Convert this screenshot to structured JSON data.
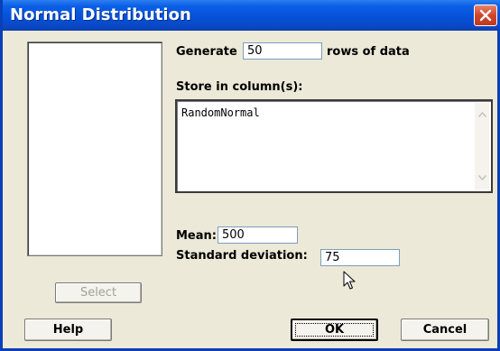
{
  "window": {
    "title": "Normal Distribution"
  },
  "icons": {
    "close": "close-icon",
    "cursor": "mouse-pointer-icon",
    "scroll_up": "scroll-up-arrow-icon",
    "scroll_down": "scroll-down-arrow-icon"
  },
  "colors": {
    "titlebar": "#0552d9",
    "close_button": "#d2452a",
    "dialog_background": "#ece9d8"
  },
  "form": {
    "generate_label": "Generate",
    "generate_value": "50",
    "rows_label": "rows of data",
    "store_label": "Store in column(s):",
    "store_value": "RandomNormal",
    "mean_label": "Mean:",
    "mean_value": "500",
    "sd_label": "Standard deviation:",
    "sd_value": "75"
  },
  "buttons": {
    "select": "Select",
    "help": "Help",
    "ok": "OK",
    "cancel": "Cancel"
  }
}
